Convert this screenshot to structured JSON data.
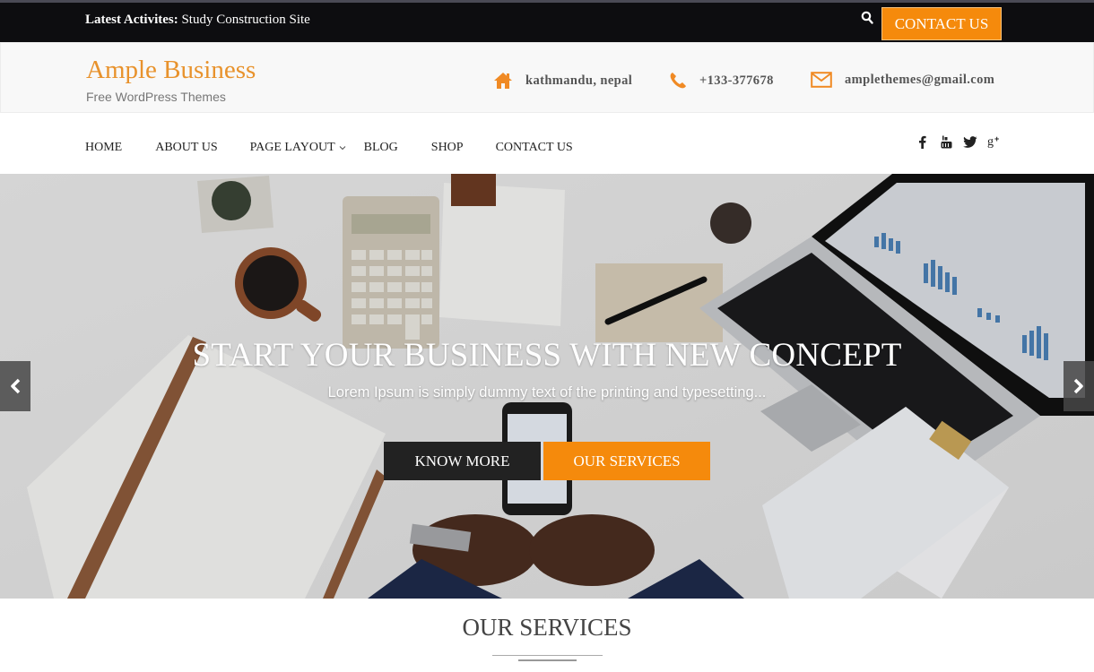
{
  "topbar": {
    "latest_label": "Latest Activites:",
    "latest_text": "Study Construction Site",
    "search_icon": "search-icon",
    "contact_button": "CONTACT US"
  },
  "header": {
    "site_title": "Ample Business",
    "tagline": "Free WordPress Themes",
    "address": "kathmandu, nepal",
    "phone": "+133-377678",
    "email": "amplethemes@gmail.com",
    "address_icon": "home-icon",
    "phone_icon": "phone-icon",
    "email_icon": "envelope-icon"
  },
  "nav": {
    "items": [
      {
        "label": "HOME"
      },
      {
        "label": "ABOUT US"
      },
      {
        "label": "PAGE LAYOUT",
        "has_dropdown": true
      },
      {
        "label": "BLOG"
      },
      {
        "label": "SHOP"
      },
      {
        "label": "CONTACT US"
      }
    ],
    "social": [
      "facebook-icon",
      "youtube-icon",
      "twitter-icon",
      "google-plus-icon"
    ]
  },
  "hero": {
    "title": "START YOUR BUSINESS WITH NEW CONCEPT",
    "subtitle": "Lorem Ipsum is simply dummy text of the printing and typesetting...",
    "primary_button": "KNOW MORE",
    "secondary_button": "OUR SERVICES",
    "prev_icon": "chevron-left-icon",
    "next_icon": "chevron-right-icon"
  },
  "services": {
    "heading": "OUR SERVICES"
  },
  "colors": {
    "accent": "#f58a0c",
    "brand_title": "#e8922c",
    "topbar_bg": "#0d0d10",
    "dark_button": "#222222"
  }
}
